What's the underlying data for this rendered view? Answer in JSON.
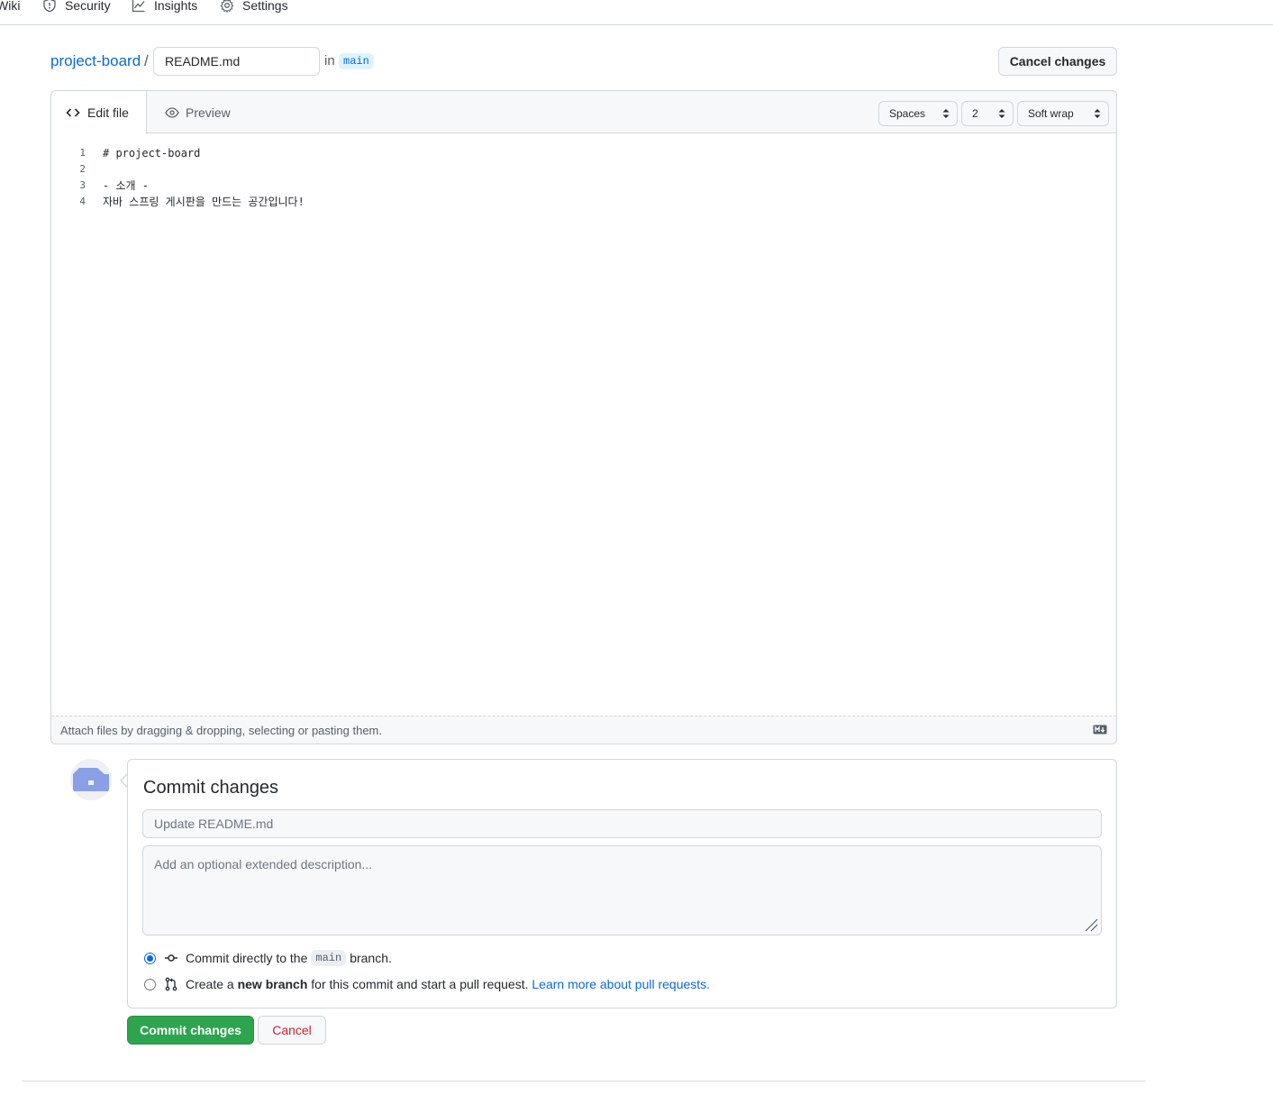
{
  "nav": {
    "items": [
      {
        "label": "Wiki",
        "icon": "book-icon"
      },
      {
        "label": "Security",
        "icon": "shield-icon"
      },
      {
        "label": "Insights",
        "icon": "graph-icon"
      },
      {
        "label": "Settings",
        "icon": "gear-icon"
      }
    ]
  },
  "breadcrumb": {
    "repo": "project-board",
    "separator": "/",
    "filename": "README.md",
    "in_label": "in",
    "branch": "main"
  },
  "header": {
    "cancel_changes": "Cancel changes"
  },
  "editor": {
    "tabs": {
      "edit": "Edit file",
      "preview": "Preview"
    },
    "indent_mode": "Spaces",
    "indent_size": "2",
    "wrap_mode": "Soft wrap",
    "lines": [
      {
        "num": "1",
        "text": "# project-board"
      },
      {
        "num": "2",
        "text": ""
      },
      {
        "num": "3",
        "text": "- 소개 -"
      },
      {
        "num": "4",
        "text": "자바 스프링 게시판을 만드는 공간입니다!"
      }
    ],
    "attach_hint": "Attach files by dragging & dropping, selecting or pasting them."
  },
  "commit": {
    "title": "Commit changes",
    "message_placeholder": "Update README.md",
    "description_placeholder": "Add an optional extended description...",
    "option_direct": {
      "prefix": "Commit directly to the",
      "branch": "main",
      "suffix": "branch."
    },
    "option_new_branch": {
      "prefix": "Create a",
      "bold": "new branch",
      "suffix": "for this commit and start a pull request.",
      "link": "Learn more about pull requests."
    },
    "submit_label": "Commit changes",
    "cancel_label": "Cancel"
  },
  "colors": {
    "link": "#0969da",
    "commit_green": "#2da44e",
    "cancel_red": "#cf222e",
    "avatar_blue": "#8aa0e6"
  }
}
